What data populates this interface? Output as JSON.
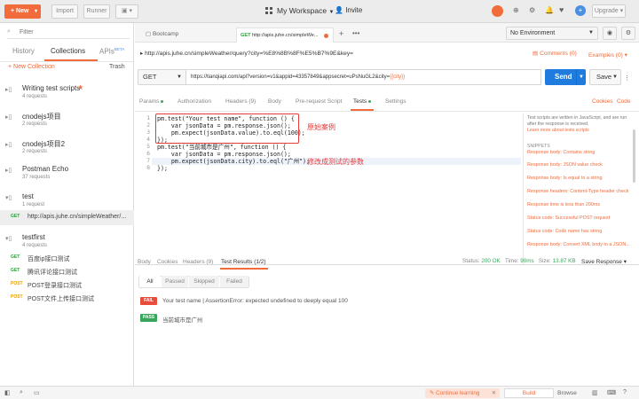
{
  "topbar": {
    "new_label": "New",
    "import_label": "Import",
    "runner_label": "Runner",
    "workspace": "My Workspace",
    "invite_label": "Invite",
    "upgrade_label": "Upgrade"
  },
  "sidebar": {
    "filter_placeholder": "Filter",
    "tab_history": "History",
    "tab_collections": "Collections",
    "tab_apis": "APIs",
    "apis_badge": "BETA",
    "new_collection": "New Collection",
    "trash": "Trash",
    "collections": [
      {
        "name": "Writing test scripts",
        "sub": "4 requests",
        "star": "★"
      },
      {
        "name": "cnodejs项目",
        "sub": "2 requests"
      },
      {
        "name": "cnodejs项目2",
        "sub": "2 requests"
      },
      {
        "name": "Postman Echo",
        "sub": "37 requests"
      },
      {
        "name": "test",
        "sub": "1 request"
      },
      {
        "name": "testfirst",
        "sub": "4 requests"
      }
    ],
    "test_request": {
      "method": "GET",
      "title": "http://apis.juhe.cn/simpleWeather/..."
    },
    "testfirst_requests": [
      {
        "method": "GET",
        "title": "百度ip接口测试",
        "color": "#2d9d3a"
      },
      {
        "method": "GET",
        "title": "腾讯评论接口测试",
        "color": "#2d9d3a"
      },
      {
        "method": "POST",
        "title": "POST登录接口测试",
        "color": "#e8a100"
      },
      {
        "method": "POST",
        "title": "POST文件上传接口测试",
        "color": "#e8a100"
      }
    ]
  },
  "tabs": [
    {
      "label": "Bootcamp"
    },
    {
      "method": "GET",
      "label": "http://apis.juhe.cn/simpleWe..."
    }
  ],
  "env": {
    "selected": "No Environment"
  },
  "request": {
    "breadcrumb": "http://apis.juhe.cn/simpleWeather/query?city=%E8%8B%8F%E5%B7%9E&key=",
    "comments": "Comments (0)",
    "examples": "Examples (0)",
    "method": "GET",
    "url_prefix": "https://tianqiapi.com/api?version=v1&appid=43357849&appsecret=uPsNuGL2&city=",
    "url_var": "{{city}}",
    "send": "Send",
    "save": "Save",
    "subtabs": [
      "Params",
      "Authorization",
      "Headers (9)",
      "Body",
      "Pre-request Script",
      "Tests",
      "Settings"
    ],
    "cookies": "Cookies",
    "code": "Code"
  },
  "editor": {
    "lines": [
      "pm.test(\"Your test name\", function () {",
      "    var jsonData = pm.response.json();",
      "    pm.expect(jsonData.value).to.eql(100);",
      "});",
      "pm.test(\"当前城市是广州\", function () {",
      "    var jsonData = pm.response.json();",
      "    pm.expect(jsonData.city).to.eql(\"广州\");",
      "});"
    ],
    "line_numbers": [
      "1",
      "2",
      "3",
      "4",
      "5",
      "6",
      "7",
      "8"
    ],
    "annot1": "原始案例",
    "annot2": "修改成测试的参数"
  },
  "snippets": {
    "intro": "Test scripts are written in JavaScript, and are run after the response is received.",
    "learn": "Learn more about tests scripts",
    "header": "SNIPPETS",
    "items": [
      "Response body: Contains string",
      "Response body: JSON value check",
      "Response body: Is equal to a string",
      "Response headers: Content-Type header check",
      "Response time is less than 200ms",
      "Status code: Successful POST request",
      "Status code: Code name has string",
      "Response body: Convert XML body to a JSON..."
    ]
  },
  "response": {
    "tabs": [
      "Body",
      "Cookies",
      "Headers (9)",
      "Test Results (1/2)"
    ],
    "status_label": "Status:",
    "status": "200 OK",
    "time_label": "Time:",
    "time": "90ms",
    "size_label": "Size:",
    "size": "13.87 KB",
    "save_response": "Save Response",
    "filters": [
      "All",
      "Passed",
      "Skipped",
      "Failed"
    ],
    "results": [
      {
        "badge": "FAIL",
        "color": "#e74c3c",
        "text": "Your test name | AssertionError: expected undefined to deeply equal 100"
      },
      {
        "badge": "PASS",
        "color": "#3aa55d",
        "text": "当前城市是广州"
      }
    ]
  },
  "footer": {
    "continue": "Continue learning",
    "build": "Build",
    "browse": "Browse"
  },
  "colors": {
    "accent": "#f26b3a",
    "send": "#1f7bde",
    "red_box": "#e43a3a"
  }
}
